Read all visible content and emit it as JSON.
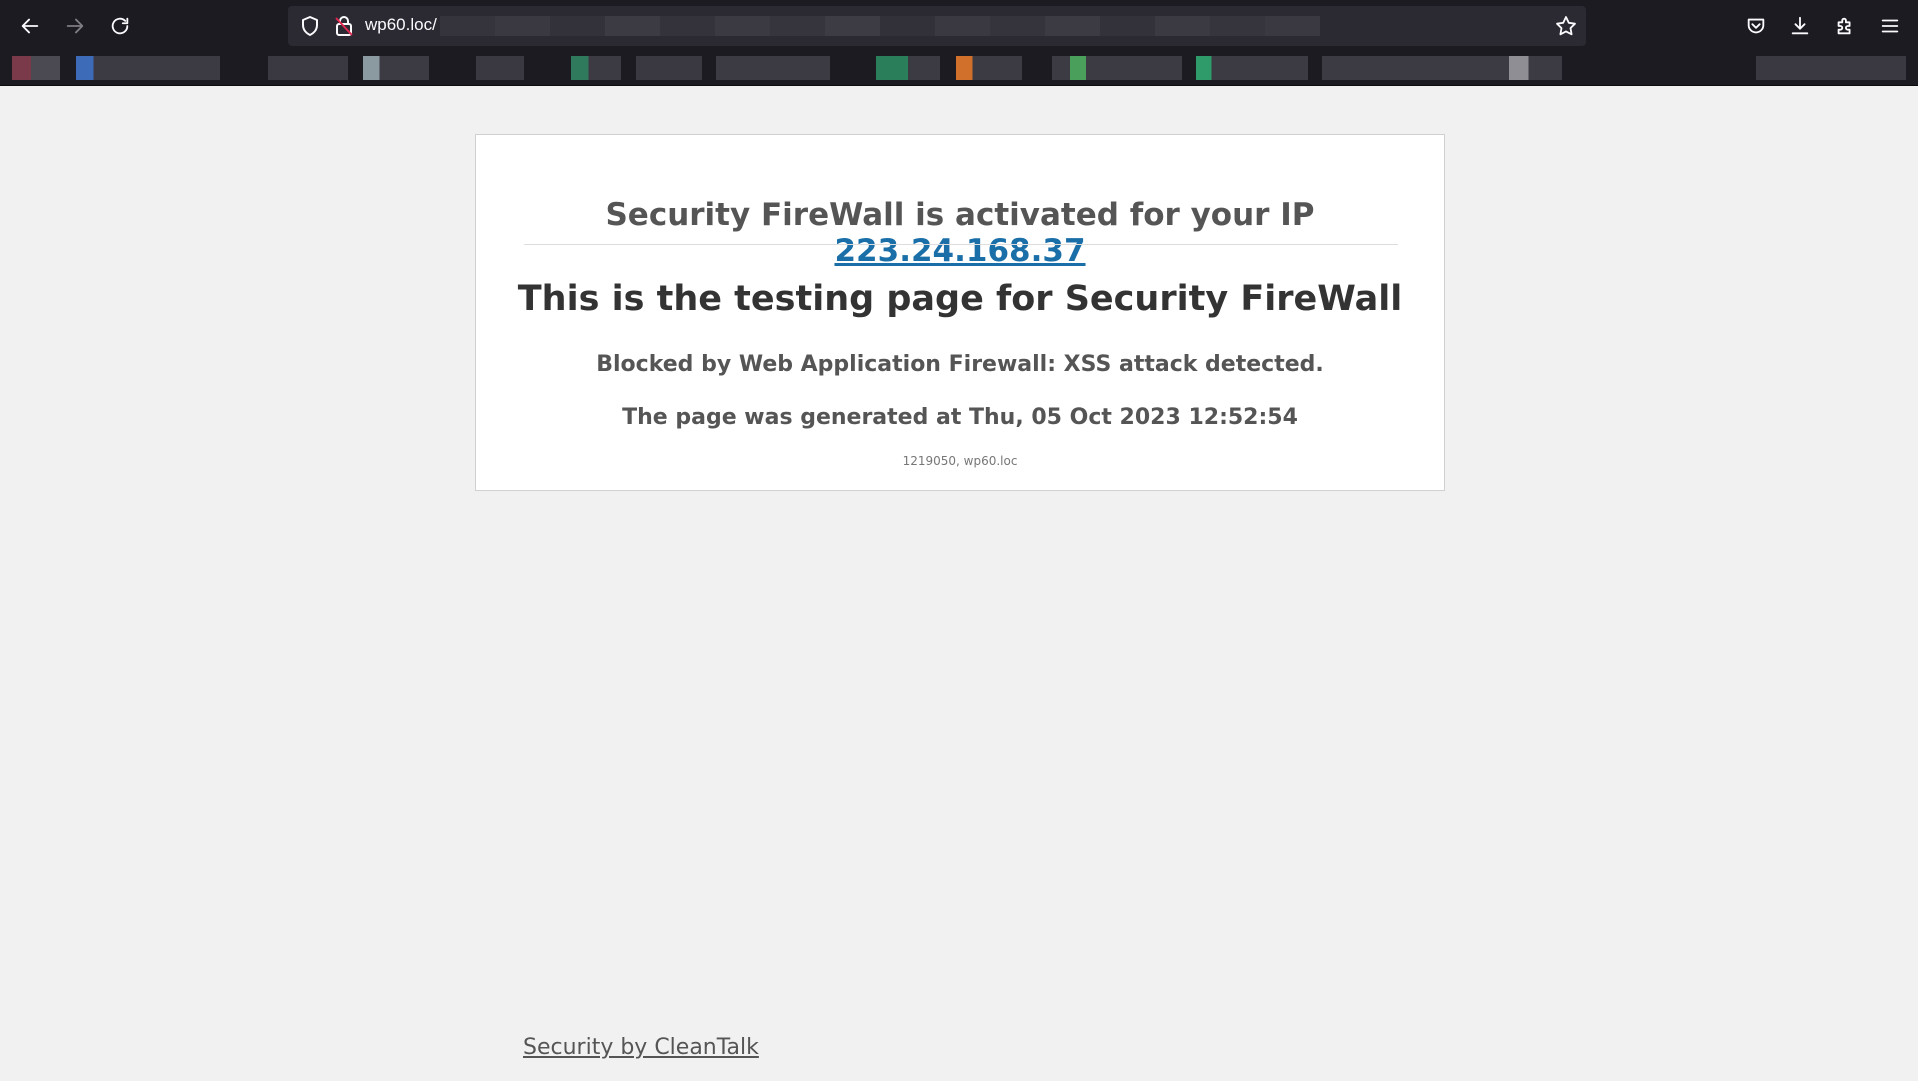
{
  "browser": {
    "url_visible": "wp60.loc/",
    "colors": {
      "chrome_bg": "#1c1b22",
      "urlbar_bg": "#2b2a33",
      "text": "#fbfbfe"
    }
  },
  "card": {
    "ip_prefix": "Security FireWall is activated for your IP",
    "ip_address": "223.24.168.37",
    "heading": "This is the testing page for Security FireWall",
    "blocked_message": "Blocked by Web Application Firewall: XSS attack detected.",
    "generated_message": "The page was generated at Thu, 05 Oct 2023 12:52:54",
    "meta": "1219050,  wp60.loc"
  },
  "footer": {
    "link_text": "Security by CleanTalk"
  },
  "colors": {
    "page_bg": "#f1f1f1",
    "link": "#1a6fa8",
    "text_dark": "#333333",
    "text_mid": "#555555"
  }
}
